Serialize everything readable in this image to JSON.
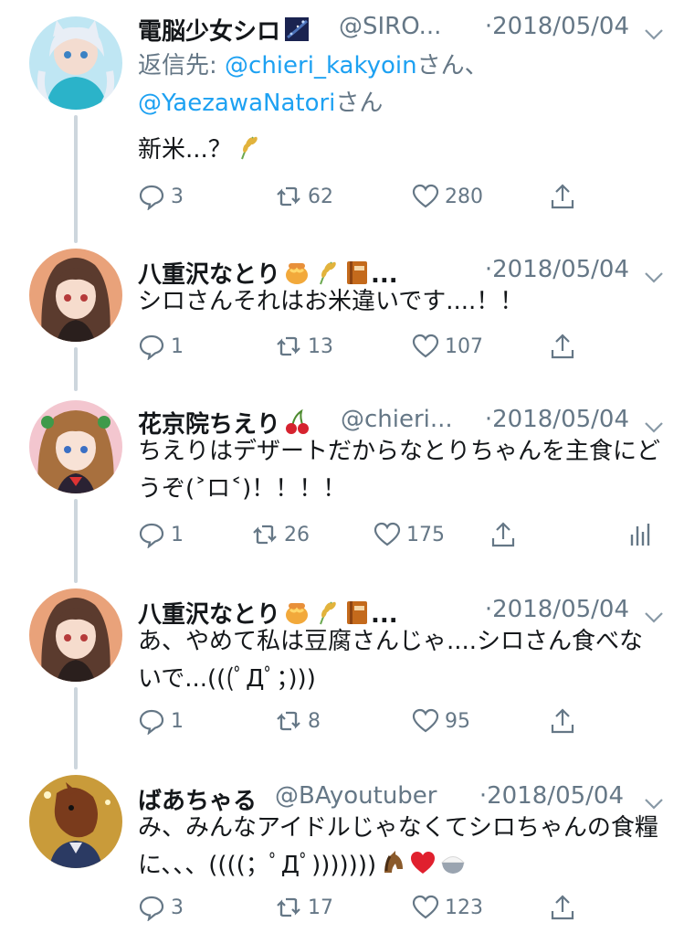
{
  "tweets": [
    {
      "name": "電脳少女シロ",
      "handle": "@SIRO...",
      "date": "·2018/05/04",
      "reply_label": "返信先: ",
      "reply_to_1": "@chieri_kakyoin",
      "reply_suffix_1": "さん、",
      "reply_to_2": "@YaezawaNatori",
      "reply_suffix_2": "さん",
      "text": "新米...？",
      "replies": "3",
      "retweets": "62",
      "likes": "280"
    },
    {
      "name": "八重沢なとり",
      "handle": "...",
      "date": "·2018/05/04",
      "text": "シロさんそれはお米違いです....！！",
      "replies": "1",
      "retweets": "13",
      "likes": "107"
    },
    {
      "name": "花京院ちえり",
      "handle": "@chieri...",
      "date": "·2018/05/04",
      "text": "ちえりはデザートだからなとりちゃんを主食にどうぞ(˃ロ˂)！！！！",
      "replies": "1",
      "retweets": "26",
      "likes": "175"
    },
    {
      "name": "八重沢なとり",
      "handle": "...",
      "date": "·2018/05/04",
      "text": "あ、やめて私は豆腐さんじゃ....シロさん食べないで...(((ﾟДﾟ；)))",
      "replies": "1",
      "retweets": "8",
      "likes": "95"
    },
    {
      "name": "ばあちゃる",
      "handle": "@BAyoutuber",
      "date": "·2018/05/04",
      "text": "み、みんなアイドルじゃなくてシロちゃんの食糧に、、、((((；ﾟДﾟ)))))))",
      "replies": "3",
      "retweets": "17",
      "likes": "123"
    }
  ],
  "icons": {
    "reply": "reply-icon",
    "retweet": "retweet-icon",
    "like": "heart-icon",
    "share": "share-icon",
    "analytics": "analytics-icon",
    "menu": "chevron-down-icon"
  },
  "colors": {
    "link": "#1da1f2",
    "muted": "#657786",
    "text": "#14171a",
    "thread_line": "#cdd6dd"
  }
}
